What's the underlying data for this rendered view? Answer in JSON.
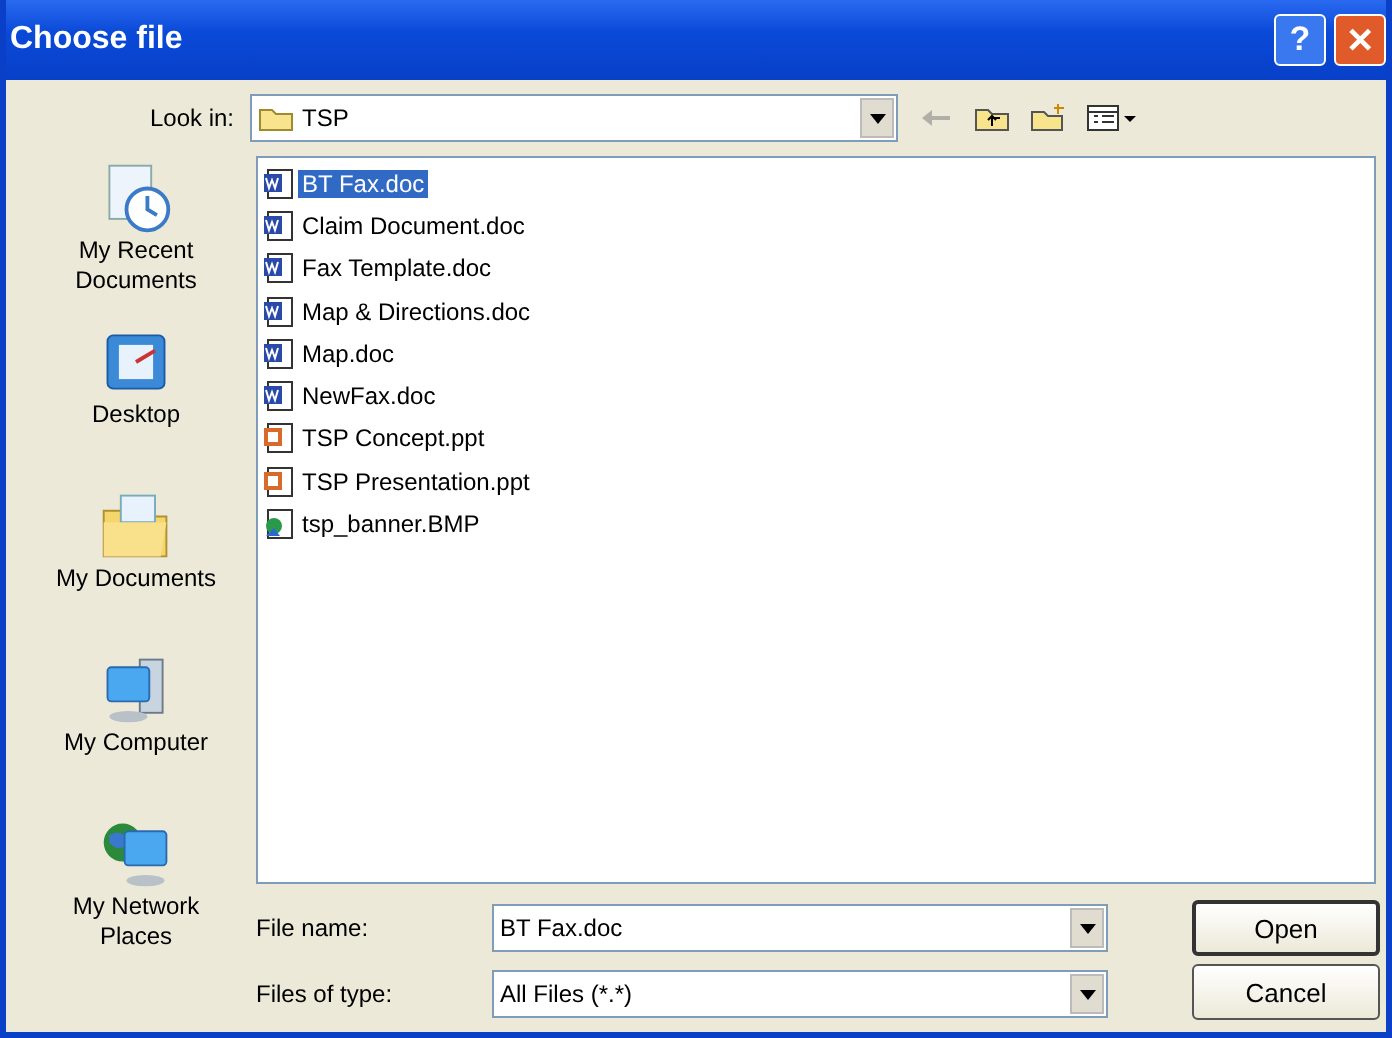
{
  "window": {
    "title": "Choose file",
    "help": "?",
    "close": "✕"
  },
  "look_in": {
    "label": "Look in:",
    "value": "TSP"
  },
  "places": [
    {
      "label": "My Recent Documents",
      "kind": "recent"
    },
    {
      "label": "Desktop",
      "kind": "desktop"
    },
    {
      "label": "My Documents",
      "kind": "documents"
    },
    {
      "label": "My Computer",
      "kind": "computer"
    },
    {
      "label": "My Network Places",
      "kind": "network"
    }
  ],
  "files": [
    {
      "name": "BT Fax.doc",
      "kind": "doc",
      "selected": true
    },
    {
      "name": "Claim Document.doc",
      "kind": "doc",
      "selected": false
    },
    {
      "name": "Fax Template.doc",
      "kind": "doc",
      "selected": false
    },
    {
      "name": "Map & Directions.doc",
      "kind": "doc",
      "selected": false
    },
    {
      "name": "Map.doc",
      "kind": "doc",
      "selected": false
    },
    {
      "name": "NewFax.doc",
      "kind": "doc",
      "selected": false
    },
    {
      "name": "TSP Concept.ppt",
      "kind": "ppt",
      "selected": false
    },
    {
      "name": "TSP Presentation.ppt",
      "kind": "ppt",
      "selected": false
    },
    {
      "name": "tsp_banner.BMP",
      "kind": "bmp",
      "selected": false
    }
  ],
  "file_name": {
    "label": "File name:",
    "value": "BT Fax.doc"
  },
  "file_type": {
    "label": "Files of type:",
    "value": "All Files (*.*)"
  },
  "buttons": [
    "Open",
    "Cancel"
  ]
}
